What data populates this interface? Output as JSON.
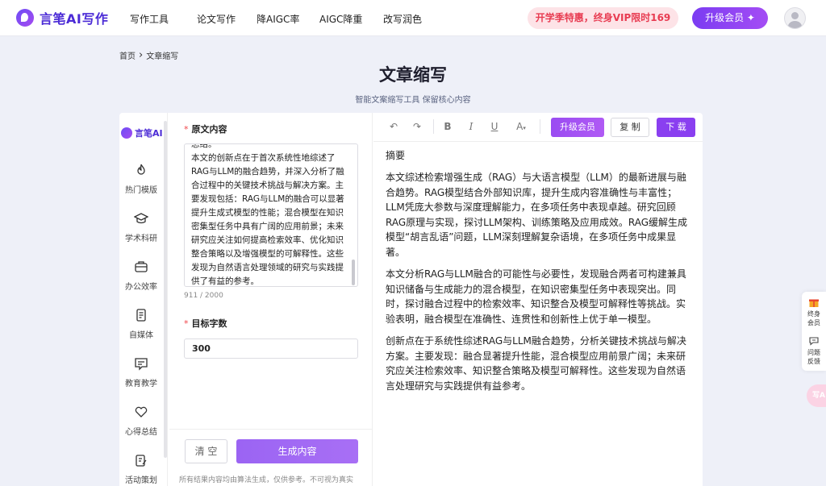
{
  "brand": {
    "name": "言笔AI写作",
    "side_name": "言笔AI"
  },
  "nav": [
    "写作工具",
    "论文写作",
    "降AIGC率",
    "AIGC降重",
    "改写润色"
  ],
  "promo": "开学季特惠，终身VIP限时169",
  "upgrade_top": "升级会员 ✦",
  "breadcrumb": {
    "home": "首页",
    "separator": "›",
    "current": "文章缩写"
  },
  "header": {
    "title": "文章缩写",
    "subtitle": "智能文案缩写工具 保留核心内容"
  },
  "sidebar": [
    {
      "label": "热门模版",
      "icon": "flame-icon"
    },
    {
      "label": "学术科研",
      "icon": "graduation-cap-icon"
    },
    {
      "label": "办公效率",
      "icon": "briefcase-icon"
    },
    {
      "label": "自媒体",
      "icon": "document-icon"
    },
    {
      "label": "教育教学",
      "icon": "chat-board-icon"
    },
    {
      "label": "心得总结",
      "icon": "heart-icon"
    },
    {
      "label": "活动策划",
      "icon": "clipboard-edit-icon"
    }
  ],
  "form": {
    "source_label": "原文内容",
    "source_text": "总结。\n本文的创新点在于首次系统性地综述了RAG与LLM的融合趋势，并深入分析了融合过程中的关键技术挑战与解决方案。主要发现包括：RAG与LLM的融合可以显著提升生成式模型的性能；混合模型在知识密集型任务中具有广阔的应用前景；未来研究应关注如何提高检索效率、优化知识整合策略以及增强模型的可解释性。这些发现为自然语言处理领域的研究与实践提供了有益的参考。",
    "char_count": "911 / 2000",
    "target_label": "目标字数",
    "target_value": "300",
    "clear_label": "清 空",
    "generate_label": "生成内容",
    "disclaimer": "所有结果内容均由算法生成，仅供参考。不可视为真实"
  },
  "toolbar": {
    "upgrade_label": "升级会员",
    "copy_label": "复 制",
    "download_label": "下 载"
  },
  "output": {
    "heading": "摘要",
    "paragraphs": [
      "本文综述检索增强生成（RAG）与大语言模型（LLM）的最新进展与融合趋势。RAG模型结合外部知识库，提升生成内容准确性与丰富性；LLM凭庞大参数与深度理解能力，在多项任务中表现卓越。研究回顾RAG原理与实现，探讨LLM架构、训练策略及应用成效。RAG缓解生成模型“胡言乱语”问题，LLM深刻理解复杂语境，在多项任务中成果显著。",
      "本文分析RAG与LLM融合的可能性与必要性，发现融合两者可构建兼具知识储备与生成能力的混合模型，在知识密集型任务中表现突出。同时，探讨融合过程中的检索效率、知识整合及模型可解释性等挑战。实验表明，融合模型在准确性、连贯性和创新性上优于单一模型。",
      "创新点在于系统性综述RAG与LLM融合趋势，分析关键技术挑战与解决方案。主要发现：融合显著提升性能，混合模型应用前景广阔；未来研究应关注检索效率、知识整合策略及模型可解释性。这些发现为自然语言处理研究与实践提供有益参考。"
    ]
  },
  "float": {
    "vip": "终身会员",
    "feedback": "问题反馈",
    "ai": "写A"
  },
  "colors": {
    "brand": "#4b2bd6",
    "accent": "#8a3ff0",
    "promo_text": "#e83c52"
  }
}
